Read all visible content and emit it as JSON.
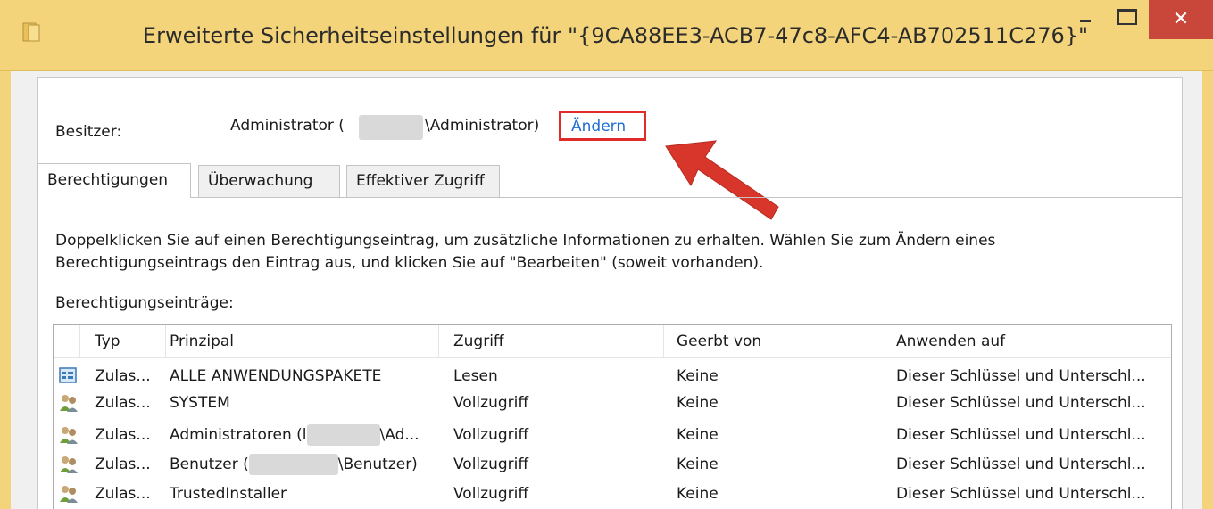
{
  "window": {
    "title": "Erweiterte Sicherheitseinstellungen für \"{9CA88EE3-ACB7-47c8-AFC4-AB702511C276}\"",
    "close_glyph": "✕",
    "frame_color": "#f4d47a",
    "close_color": "#c8473a"
  },
  "owner": {
    "label": "Besitzer:",
    "value_prefix": "Administrator (",
    "value_suffix": "\\Administrator)",
    "change_link": "Ändern",
    "highlight_color": "#e02b2b"
  },
  "tabs": [
    {
      "label": "Berechtigungen",
      "active": true
    },
    {
      "label": "Überwachung",
      "active": false
    },
    {
      "label": "Effektiver Zugriff",
      "active": false
    }
  ],
  "description": "Doppelklicken Sie auf einen Berechtigungseintrag, um zusätzliche Informationen zu erhalten. Wählen Sie zum Ändern eines Berechtigungseintrags den Eintrag aus, und klicken Sie auf \"Bearbeiten\" (soweit vorhanden).",
  "entries_caption": "Berechtigungseinträge:",
  "columns": [
    "Typ",
    "Prinzipal",
    "Zugriff",
    "Geerbt von",
    "Anwenden auf"
  ],
  "rows": [
    {
      "icon": "app-package-icon",
      "type": "Zulas...",
      "principal": "ALLE ANWENDUNGSPAKETE",
      "access": "Lesen",
      "inherited": "Keine",
      "applies": "Dieser Schlüssel und Unterschl..."
    },
    {
      "icon": "user-group-icon",
      "type": "Zulas...",
      "principal": "SYSTEM",
      "access": "Vollzugriff",
      "inherited": "Keine",
      "applies": "Dieser Schlüssel und Unterschl..."
    },
    {
      "icon": "user-group-icon",
      "type": "Zulas...",
      "principal_prefix": "Administratoren (l",
      "principal_suffix": "\\Ad...",
      "access": "Vollzugriff",
      "inherited": "Keine",
      "applies": "Dieser Schlüssel und Unterschl..."
    },
    {
      "icon": "user-group-icon",
      "type": "Zulas...",
      "principal_prefix": "Benutzer (",
      "principal_suffix": "\\Benutzer)",
      "access": "Vollzugriff",
      "inherited": "Keine",
      "applies": "Dieser Schlüssel und Unterschl..."
    },
    {
      "icon": "user-group-icon",
      "type": "Zulas...",
      "principal": "TrustedInstaller",
      "access": "Vollzugriff",
      "inherited": "Keine",
      "applies": "Dieser Schlüssel und Unterschl..."
    }
  ]
}
